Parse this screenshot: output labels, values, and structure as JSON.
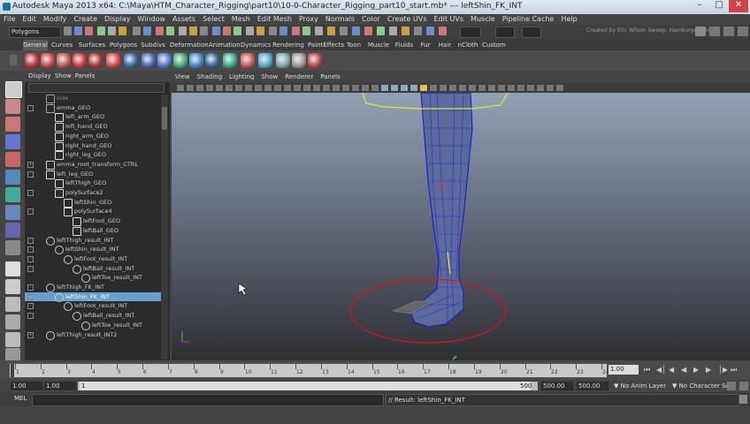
{
  "title": {
    "app": "Autodesk Maya 2013 x64: C:\\Maya\\HTM_Character_Rigging\\part10\\10-0-Character_Rigging_part10_start.mb*",
    "separator": "---",
    "selection": "leftShin_FK_INT"
  },
  "menubar": [
    "File",
    "Edit",
    "Modify",
    "Create",
    "Display",
    "Window",
    "Assets",
    "Select",
    "Mesh",
    "Edit Mesh",
    "Proxy",
    "Normals",
    "Color",
    "Create UVs",
    "Edit UVs",
    "Muscle",
    "Pipeline Cache",
    "Help"
  ],
  "status": {
    "mode": "Polygons",
    "credit": "Created by Eric Wilson Sweep: Hamburger BAM"
  },
  "shelf_tabs": [
    "General",
    "Curves",
    "Surfaces",
    "Polygons",
    "Subdivs",
    "Deformation",
    "Animation",
    "Dynamics",
    "Rendering",
    "PaintEffects",
    "Toon",
    "Muscle",
    "Fluids",
    "Fur",
    "Hair",
    "nCloth",
    "Custom"
  ],
  "shelf_active": "General",
  "outliner": {
    "menu": [
      "Display",
      "Show",
      "Panels"
    ],
    "rows": [
      {
        "label": "side",
        "indent": 0,
        "kind": "camera",
        "exp": ""
      },
      {
        "label": "emma_GEO",
        "indent": 0,
        "kind": "group",
        "exp": "-"
      },
      {
        "label": "left_arm_GEO",
        "indent": 1,
        "kind": "mesh",
        "exp": ""
      },
      {
        "label": "left_hand_GEO",
        "indent": 1,
        "kind": "mesh",
        "exp": ""
      },
      {
        "label": "right_arm_GEO",
        "indent": 1,
        "kind": "mesh",
        "exp": ""
      },
      {
        "label": "right_hand_GEO",
        "indent": 1,
        "kind": "mesh",
        "exp": ""
      },
      {
        "label": "right_leg_GEO",
        "indent": 1,
        "kind": "mesh",
        "exp": ""
      },
      {
        "label": "emma_root_transform_CTRL",
        "indent": 0,
        "kind": "curve",
        "exp": "+"
      },
      {
        "label": "left_leg_GEO",
        "indent": 0,
        "kind": "mesh",
        "exp": "-"
      },
      {
        "label": "leftThigh_GEO",
        "indent": 1,
        "kind": "mesh",
        "exp": ""
      },
      {
        "label": "polySurface2",
        "indent": 1,
        "kind": "mesh",
        "exp": "-"
      },
      {
        "label": "leftShin_GEO",
        "indent": 2,
        "kind": "mesh",
        "exp": ""
      },
      {
        "label": "polySurface4",
        "indent": 2,
        "kind": "mesh",
        "exp": "-"
      },
      {
        "label": "leftFoot_GEO",
        "indent": 3,
        "kind": "mesh",
        "exp": ""
      },
      {
        "label": "leftBall_GEO",
        "indent": 3,
        "kind": "mesh",
        "exp": ""
      },
      {
        "label": "leftThigh_result_INT",
        "indent": 0,
        "kind": "joint",
        "exp": "-"
      },
      {
        "label": "leftShin_result_INT",
        "indent": 1,
        "kind": "joint",
        "exp": "-"
      },
      {
        "label": "leftFoot_result_INT",
        "indent": 2,
        "kind": "joint",
        "exp": "-"
      },
      {
        "label": "leftBall_result_INT",
        "indent": 3,
        "kind": "joint",
        "exp": "-"
      },
      {
        "label": "leftToe_result_INT",
        "indent": 4,
        "kind": "joint",
        "exp": ""
      },
      {
        "label": "leftThigh_FK_INT",
        "indent": 0,
        "kind": "joint",
        "exp": "-"
      },
      {
        "label": "leftShin_FK_INT",
        "indent": 1,
        "kind": "joint",
        "exp": "-",
        "selected": true
      },
      {
        "label": "leftFoot_result_INT",
        "indent": 2,
        "kind": "joint",
        "exp": "-"
      },
      {
        "label": "leftBall_result_INT",
        "indent": 3,
        "kind": "joint",
        "exp": "-"
      },
      {
        "label": "leftToe_result_INT",
        "indent": 4,
        "kind": "joint",
        "exp": ""
      },
      {
        "label": "leftThigh_result_INT2",
        "indent": 0,
        "kind": "joint",
        "exp": "+"
      }
    ]
  },
  "viewport": {
    "menu": [
      "View",
      "Shading",
      "Lighting",
      "Show",
      "Renderer",
      "Panels"
    ]
  },
  "timeline": {
    "ticks": [
      "1",
      "2",
      "3",
      "4",
      "5",
      "6",
      "7",
      "8",
      "9",
      "10",
      "11",
      "12",
      "13",
      "14",
      "15",
      "16",
      "17",
      "18",
      "19",
      "20",
      "21",
      "22",
      "23",
      "24"
    ],
    "current": "1.00"
  },
  "range": {
    "start": "1.00",
    "inner_start": "1.00",
    "inner_start_marker": "1",
    "inner_end_marker": "500",
    "end": "500.00",
    "end2": "500.00",
    "anim_layer": "No Anim Layer",
    "char_set": "No Character Set"
  },
  "cmd": {
    "label": "MEL",
    "result": "// Result: leftShin_FK_INT"
  },
  "colors": {
    "selected_row": "#68a0d0",
    "wireframe": "#1a22cc",
    "selection_yellow": "#e8e830",
    "ctrl_red": "#d01818"
  }
}
